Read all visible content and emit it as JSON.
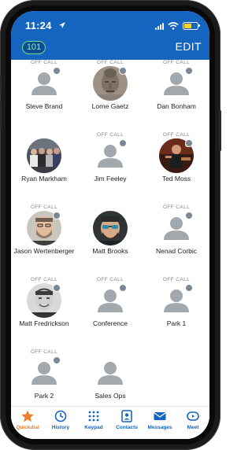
{
  "status_bar": {
    "time": "11:24"
  },
  "header": {
    "count": "101",
    "edit_label": "EDIT"
  },
  "off_call_label": "OFF CALL",
  "contacts": [
    {
      "name": "Steve Brand",
      "off_call": true,
      "photo": "placeholder"
    },
    {
      "name": "Lorne Gaetz",
      "off_call": true,
      "photo": "statue"
    },
    {
      "name": "Dan Bonham",
      "off_call": true,
      "photo": "placeholder"
    },
    {
      "name": "Ryan Markham",
      "off_call": false,
      "photo": "group"
    },
    {
      "name": "Jim Feeley",
      "off_call": true,
      "photo": "placeholder"
    },
    {
      "name": "Ted Moss",
      "off_call": true,
      "photo": "performer"
    },
    {
      "name": "Jason Wertenberger",
      "off_call": true,
      "photo": "bearded"
    },
    {
      "name": "Matt Brooks",
      "off_call": false,
      "photo": "sunglasses"
    },
    {
      "name": "Nenad Corbic",
      "off_call": true,
      "photo": "placeholder"
    },
    {
      "name": "Matt Fredrickson",
      "off_call": true,
      "photo": "smiling"
    },
    {
      "name": "Conference",
      "off_call": true,
      "photo": "placeholder"
    },
    {
      "name": "Park 1",
      "off_call": true,
      "photo": "placeholder"
    },
    {
      "name": "Park 2",
      "off_call": true,
      "photo": "placeholder"
    },
    {
      "name": "Sales Ops",
      "off_call": false,
      "photo": "placeholder"
    }
  ],
  "tabs": [
    {
      "label": "Quickdial",
      "icon": "star-icon",
      "active": true
    },
    {
      "label": "History",
      "icon": "clock-icon",
      "active": false
    },
    {
      "label": "Keypad",
      "icon": "keypad-icon",
      "active": false
    },
    {
      "label": "Contacts",
      "icon": "contact-card-icon",
      "active": false
    },
    {
      "label": "Messages",
      "icon": "envelope-icon",
      "active": false
    },
    {
      "label": "Meet",
      "icon": "video-camera-icon",
      "active": false
    }
  ],
  "colors": {
    "header_bg": "#1565c0",
    "accent": "#f07d2e",
    "badge_border": "#6fe08a",
    "presence": "#7b8797"
  }
}
